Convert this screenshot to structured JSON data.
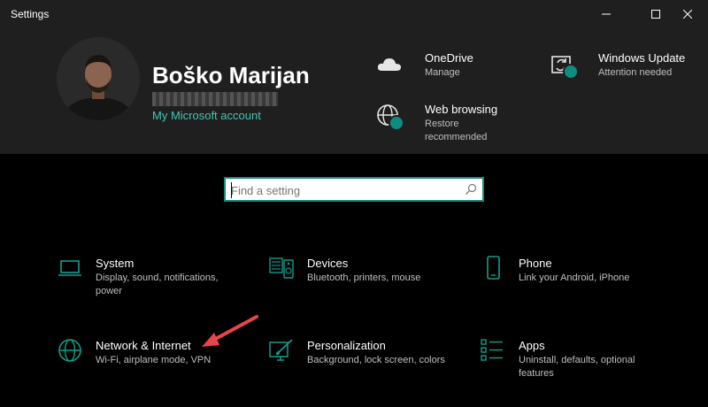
{
  "window": {
    "title": "Settings"
  },
  "account": {
    "name": "Boško Marijan",
    "link": "My Microsoft account"
  },
  "quick_links": [
    {
      "title": "OneDrive",
      "subtitle": "Manage",
      "icon": "cloud-icon"
    },
    {
      "title": "Windows Update",
      "subtitle": "Attention needed",
      "icon": "update-icon"
    },
    {
      "title": "Web browsing",
      "subtitle_lines": [
        "Restore",
        "recommended"
      ],
      "icon": "globe-icon"
    }
  ],
  "search": {
    "placeholder": "Find a setting"
  },
  "categories": [
    {
      "title": "System",
      "subtitle_lines": [
        "Display, sound, notifications,",
        "power"
      ],
      "icon": "laptop-icon"
    },
    {
      "title": "Devices",
      "subtitle_lines": [
        "Bluetooth, printers, mouse"
      ],
      "icon": "devices-icon"
    },
    {
      "title": "Phone",
      "subtitle_lines": [
        "Link your Android, iPhone"
      ],
      "icon": "phone-icon"
    },
    {
      "title": "Network & Internet",
      "subtitle_lines": [
        "Wi-Fi, airplane mode, VPN"
      ],
      "icon": "globe-icon"
    },
    {
      "title": "Personalization",
      "subtitle_lines": [
        "Background, lock screen, colors"
      ],
      "icon": "paintbrush-icon"
    },
    {
      "title": "Apps",
      "subtitle_lines": [
        "Uninstall, defaults, optional",
        "features"
      ],
      "icon": "apps-list-icon"
    }
  ],
  "colors": {
    "accent": "#0e8c7e",
    "link": "#3fc8b4",
    "annotation_arrow": "#e8454a",
    "header_bg": "#1f1f1f",
    "body_bg": "#000000"
  }
}
